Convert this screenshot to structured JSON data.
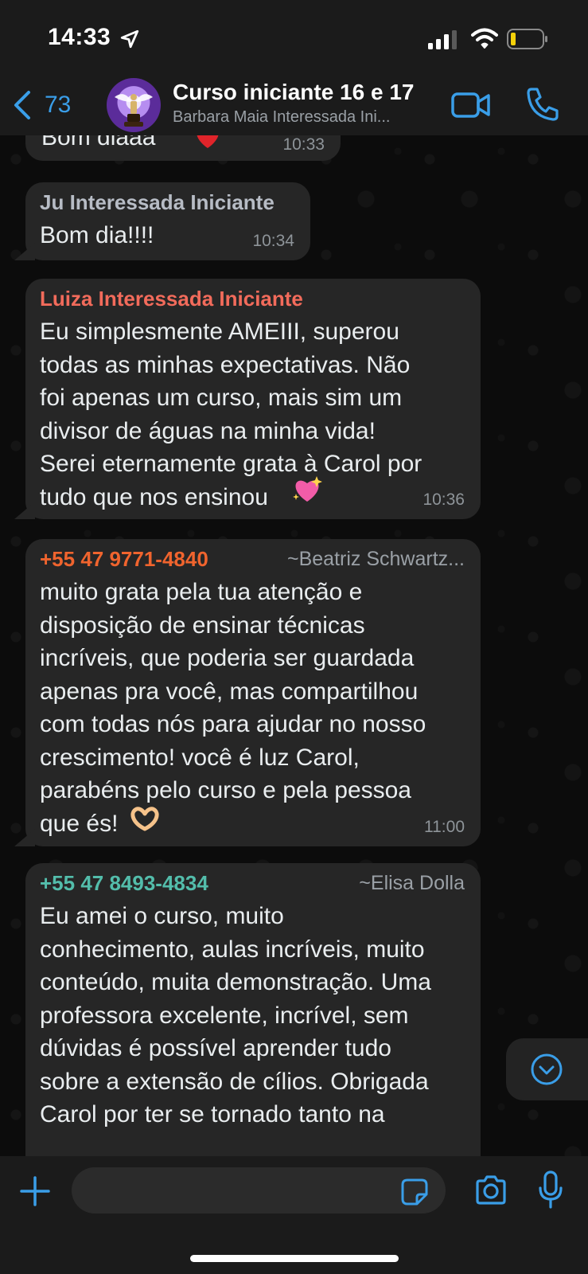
{
  "status_bar": {
    "time": "14:33"
  },
  "header": {
    "back_count": "73",
    "title": "Curso iniciante 16 e 17",
    "subtitle": "Barbara Maia Interessada Ini..."
  },
  "messages": [
    {
      "sender": "",
      "text": "Bom diaaa",
      "emoji": "heart",
      "time": "10:33"
    },
    {
      "sender": "Ju Interessada Iniciante",
      "sender_color": "#b7bcc5",
      "text": "Bom dia!!!!",
      "time": "10:34"
    },
    {
      "sender": "Luiza Interessada Iniciante",
      "sender_color": "#f26b5b",
      "text": "Eu simplesmente AMEIII, superou\ntodas as minhas expectativas. Não\nfoi apenas um curso, mais sim um\ndivisor de águas na minha vida!\nSerei eternamente grata à Carol por\ntudo que nos ensinou",
      "emoji": "sparkling-heart",
      "time": "10:36"
    },
    {
      "sender": "+55 47 9771-4840",
      "sender_color": "#f0642e",
      "alias": "~Beatriz Schwartz...",
      "text": "muito grata pela tua atenção e\ndisposição de ensinar técnicas\nincríveis, que poderia ser guardada\napenas pra você, mas compartilhou\ncom todas nós para ajudar no nosso\ncrescimento! você é luz Carol,\nparabéns pelo curso e pela pessoa\nque és!",
      "emoji": "heart-hands",
      "time": "11:00"
    },
    {
      "sender": "+55 47 8493-4834",
      "sender_color": "#53bdab",
      "alias": "~Elisa Dolla",
      "text": "Eu amei o curso, muito\nconhecimento, aulas incríveis, muito\nconteúdo, muita demonstração. Uma\nprofessora excelente, incrível, sem\ndúvidas é possível aprender tudo\nsobre a extensão de cílios. Obrigada\nCarol por ter se tornado tanto na"
    }
  ],
  "input": {
    "placeholder": ""
  },
  "colors": {
    "accent": "#3a9ee8",
    "bubble": "#262626",
    "bar": "#1b1b1b"
  }
}
